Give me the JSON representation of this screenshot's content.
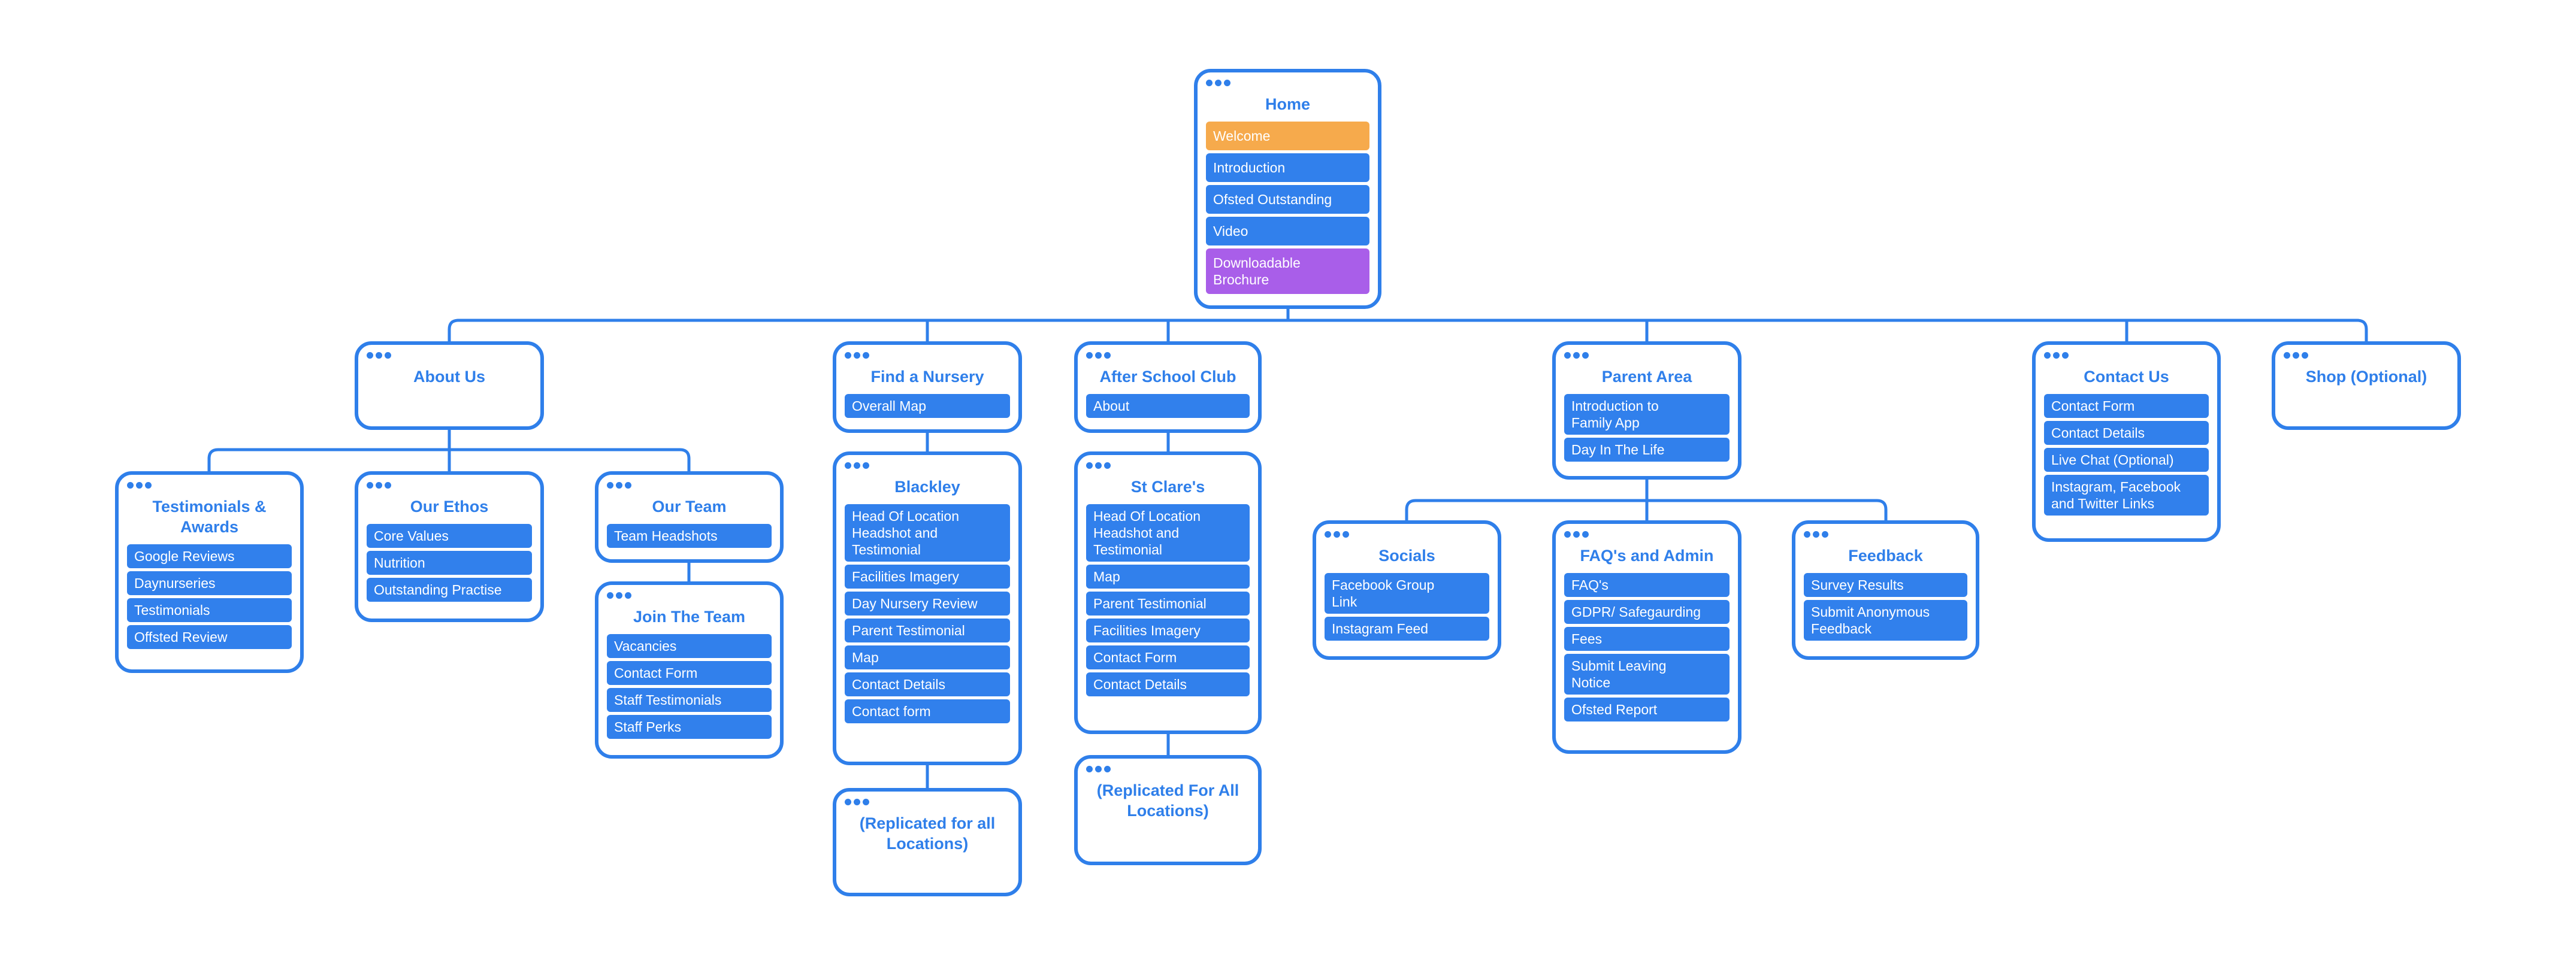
{
  "colors": {
    "accent": "#2f7fea",
    "item": "#3180ec",
    "highlight_orange": "#f6aa4c",
    "highlight_purple": "#a95ee9"
  },
  "cards": {
    "home": {
      "title": "Home",
      "items": [
        {
          "label": "Welcome",
          "color": "#f6aa4c"
        },
        {
          "label": "Introduction"
        },
        {
          "label": "Ofsted Outstanding"
        },
        {
          "label": "Video"
        },
        {
          "label": "Downloadable\nBrochure",
          "color": "#a95ee9"
        }
      ]
    },
    "about": {
      "title": "About Us",
      "items": []
    },
    "find": {
      "title": "Find a Nursery",
      "items": [
        {
          "label": "Overall Map"
        }
      ]
    },
    "after": {
      "title": "After School Club",
      "items": [
        {
          "label": "About"
        }
      ]
    },
    "parent": {
      "title": "Parent Area",
      "items": [
        {
          "label": "Introduction to\nFamily App"
        },
        {
          "label": "Day In The Life"
        }
      ]
    },
    "contact": {
      "title": "Contact Us",
      "items": [
        {
          "label": "Contact Form"
        },
        {
          "label": "Contact Details"
        },
        {
          "label": "Live Chat (Optional)"
        },
        {
          "label": "Instagram, Facebook\nand Twitter Links"
        }
      ]
    },
    "shop": {
      "title": "Shop (Optional)",
      "items": []
    },
    "testimonials": {
      "title": "Testimonials &\nAwards",
      "items": [
        {
          "label": "Google Reviews"
        },
        {
          "label": "Daynurseries"
        },
        {
          "label": "Testimonials"
        },
        {
          "label": "Offsted Review"
        }
      ]
    },
    "ethos": {
      "title": "Our Ethos",
      "items": [
        {
          "label": "Core Values"
        },
        {
          "label": "Nutrition"
        },
        {
          "label": "Outstanding Practise"
        }
      ]
    },
    "team": {
      "title": "Our Team",
      "items": [
        {
          "label": "Team Headshots"
        }
      ]
    },
    "join": {
      "title": "Join The Team",
      "items": [
        {
          "label": "Vacancies"
        },
        {
          "label": "Contact Form"
        },
        {
          "label": "Staff Testimonials"
        },
        {
          "label": "Staff Perks"
        }
      ]
    },
    "blackley": {
      "title": "Blackley",
      "items": [
        {
          "label": "Head Of Location\nHeadshot and\nTestimonial"
        },
        {
          "label": "Facilities Imagery"
        },
        {
          "label": "Day Nursery Review"
        },
        {
          "label": "Parent Testimonial"
        },
        {
          "label": "Map"
        },
        {
          "label": "Contact Details"
        },
        {
          "label": "Contact form"
        }
      ]
    },
    "repl_left": {
      "title": "(Replicated for all\nLocations)",
      "items": []
    },
    "stclare": {
      "title": "St Clare's",
      "items": [
        {
          "label": "Head Of Location\nHeadshot and\nTestimonial"
        },
        {
          "label": "Map"
        },
        {
          "label": "Parent Testimonial"
        },
        {
          "label": "Facilities Imagery"
        },
        {
          "label": "Contact Form"
        },
        {
          "label": "Contact Details"
        }
      ]
    },
    "repl_right": {
      "title": "(Replicated For All\nLocations)",
      "items": []
    },
    "socials": {
      "title": "Socials",
      "items": [
        {
          "label": "Facebook Group\nLink"
        },
        {
          "label": "Instagram Feed"
        }
      ]
    },
    "faq": {
      "title": "FAQ's and Admin",
      "items": [
        {
          "label": "FAQ's"
        },
        {
          "label": "GDPR/ Safegaurding"
        },
        {
          "label": "Fees"
        },
        {
          "label": "Submit Leaving\nNotice"
        },
        {
          "label": "Ofsted Report"
        }
      ]
    },
    "feedback": {
      "title": "Feedback",
      "items": [
        {
          "label": "Survey Results"
        },
        {
          "label": "Submit Anonymous\nFeedback"
        }
      ]
    }
  }
}
